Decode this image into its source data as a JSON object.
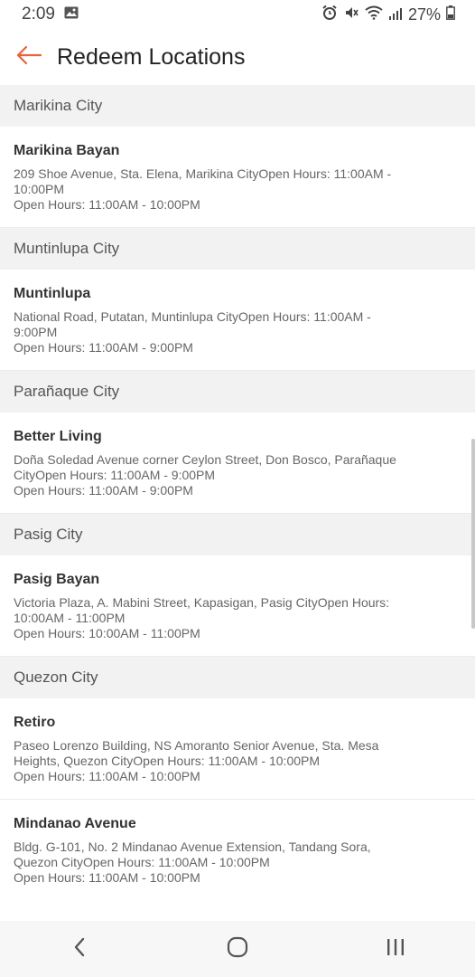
{
  "status_bar": {
    "time": "2:09",
    "battery": "27%"
  },
  "app_bar": {
    "title": "Redeem Locations",
    "accent_color": "#e8633a"
  },
  "sections": [
    {
      "city": "Marikina City",
      "locations": [
        {
          "name": "Marikina Bayan",
          "address": "209 Shoe Avenue, Sta. Elena, Marikina CityOpen Hours: 11:00AM - 10:00PM",
          "hours": "Open Hours: 11:00AM - 10:00PM"
        }
      ]
    },
    {
      "city": "Muntinlupa City",
      "locations": [
        {
          "name": "Muntinlupa",
          "address": "National Road, Putatan, Muntinlupa CityOpen Hours: 11:00AM - 9:00PM",
          "hours": "Open Hours: 11:00AM - 9:00PM"
        }
      ]
    },
    {
      "city": "Parañaque City",
      "locations": [
        {
          "name": "Better Living",
          "address": "Doña Soledad Avenue corner Ceylon Street, Don Bosco, Parañaque CityOpen Hours: 11:00AM - 9:00PM",
          "hours": "Open Hours: 11:00AM - 9:00PM"
        }
      ]
    },
    {
      "city": "Pasig City",
      "locations": [
        {
          "name": "Pasig Bayan",
          "address": "Victoria Plaza, A. Mabini Street, Kapasigan, Pasig CityOpen Hours: 10:00AM - 11:00PM",
          "hours": "Open Hours: 10:00AM - 11:00PM"
        }
      ]
    },
    {
      "city": "Quezon City",
      "locations": [
        {
          "name": "Retiro",
          "address": "Paseo Lorenzo Building, NS Amoranto Senior Avenue, Sta. Mesa Heights, Quezon CityOpen Hours: 11:00AM - 10:00PM",
          "hours": "Open Hours: 11:00AM - 10:00PM"
        },
        {
          "name": "Mindanao Avenue",
          "address": "Bldg. G-101, No. 2 Mindanao Avenue Extension, Tandang Sora, Quezon CityOpen Hours: 11:00AM - 10:00PM",
          "hours": "Open Hours: 11:00AM - 10:00PM"
        }
      ]
    }
  ],
  "nav_bar": {
    "back_icon": "chevron-left-icon",
    "home_icon": "home-circle-icon",
    "recents_icon": "recents-bars-icon"
  }
}
